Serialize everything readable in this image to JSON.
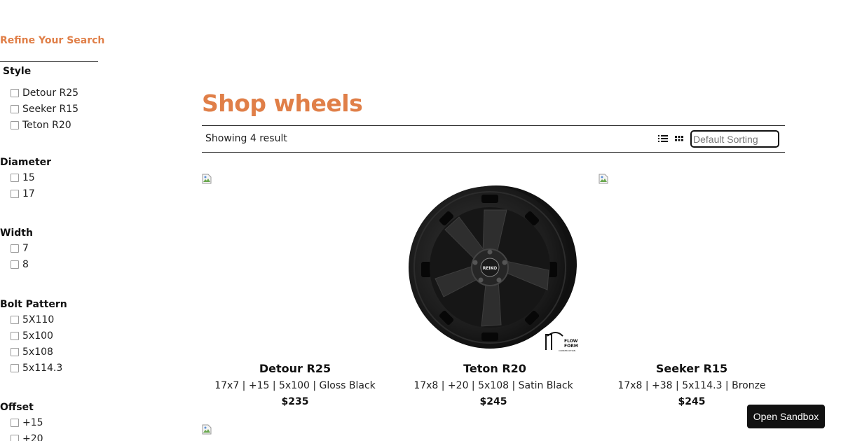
{
  "sidebar": {
    "title": "Refine Your Search",
    "groups": [
      {
        "heading": "Style",
        "options": [
          "Detour R25",
          "Seeker R15",
          "Teton R20"
        ]
      },
      {
        "heading": "Diameter",
        "options": [
          "15",
          "17"
        ]
      },
      {
        "heading": "Width",
        "options": [
          "7",
          "8"
        ]
      },
      {
        "heading": "Bolt Pattern",
        "options": [
          "5X110",
          "5x100",
          "5x108",
          "5x114.3"
        ]
      },
      {
        "heading": "Offset",
        "options": [
          "+15",
          "+20"
        ]
      }
    ]
  },
  "main": {
    "title": "Shop wheels",
    "result_count": "Showing 4 result",
    "sort": {
      "value": "Default Sorting"
    },
    "products": [
      {
        "name": "Detour R25",
        "specs": "17x7 | +15 | 5x100 | Gloss Black",
        "price": "$235",
        "image": "broken-image"
      },
      {
        "name": "Teton R20",
        "specs": "17x8 | +20 | 5x108 | Satin Black",
        "price": "$245",
        "image": "wheel-photo",
        "brand_mark": "REIKO",
        "badge_lines": [
          "FLOW",
          "FORM",
          "CONSTRUCTION"
        ]
      },
      {
        "name": "Seeker R15",
        "specs": "17x8 | +38 | 5x114.3 | Bronze",
        "price": "$245",
        "image": "broken-image"
      }
    ]
  },
  "sandbox_button": {
    "label": "Open Sandbox"
  },
  "colors": {
    "accent": "#e07f48",
    "text": "#111111",
    "button_bg": "#111111"
  }
}
